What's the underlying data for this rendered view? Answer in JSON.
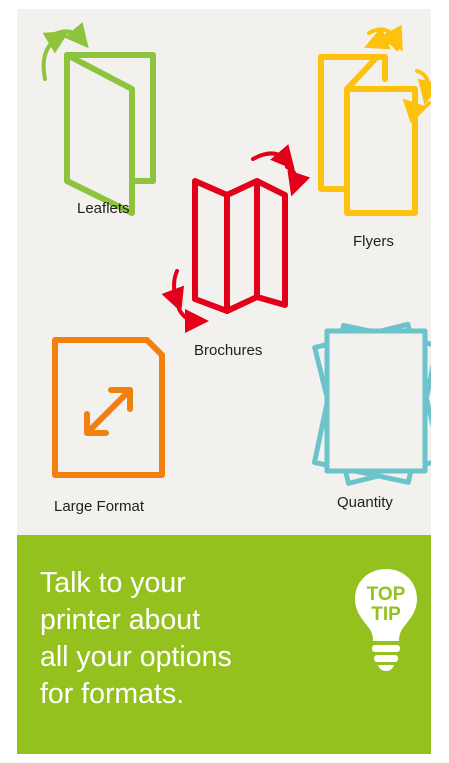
{
  "formats": {
    "leaflets": "Leaflets",
    "flyers": "Flyers",
    "brochures": "Brochures",
    "large_format": "Large Format",
    "quantity": "Quantity"
  },
  "icons": {
    "leaflets": "folded-leaflet-icon",
    "flyers": "stacked-flyers-icon",
    "brochures": "tri-fold-brochure-icon",
    "large_format": "resize-document-icon",
    "quantity": "paper-stack-icon",
    "tip": "lightbulb-icon"
  },
  "colors": {
    "leaflets": "#8dc33d",
    "flyers": "#fec20e",
    "brochures": "#e3001b",
    "large_format": "#f2800e",
    "quantity": "#6cc3cb",
    "tip_background": "#95c11f"
  },
  "tip": {
    "badge_line1": "TOP",
    "badge_line2": "TIP",
    "message_line1": "Talk to your",
    "message_line2": "printer about",
    "message_line3": "all your options",
    "message_line4": "for formats."
  }
}
